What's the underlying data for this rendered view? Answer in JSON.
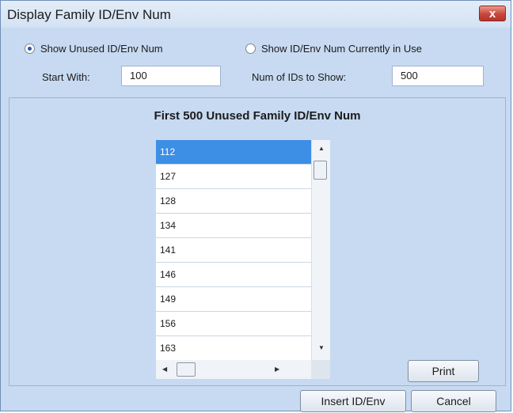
{
  "window": {
    "title": "Display Family ID/Env Num",
    "close_symbol": "x"
  },
  "options": {
    "unused_label": "Show Unused ID/Env Num",
    "in_use_label": "Show ID/Env Num Currently in Use",
    "selected": "unused"
  },
  "inputs": {
    "start_with_label": "Start With:",
    "start_with_value": "100",
    "num_ids_label": "Num of IDs to Show:",
    "num_ids_value": "500"
  },
  "panel": {
    "title": "First 500 Unused Family ID/Env Num",
    "items": [
      "112",
      "127",
      "128",
      "134",
      "141",
      "146",
      "149",
      "156",
      "163"
    ],
    "selected_index": 0
  },
  "buttons": {
    "print": "Print",
    "insert": "Insert ID/Env",
    "cancel": "Cancel"
  },
  "icons": {
    "scroll_up": "▲",
    "scroll_down": "▼",
    "scroll_left": "◀",
    "scroll_right": "▶"
  }
}
